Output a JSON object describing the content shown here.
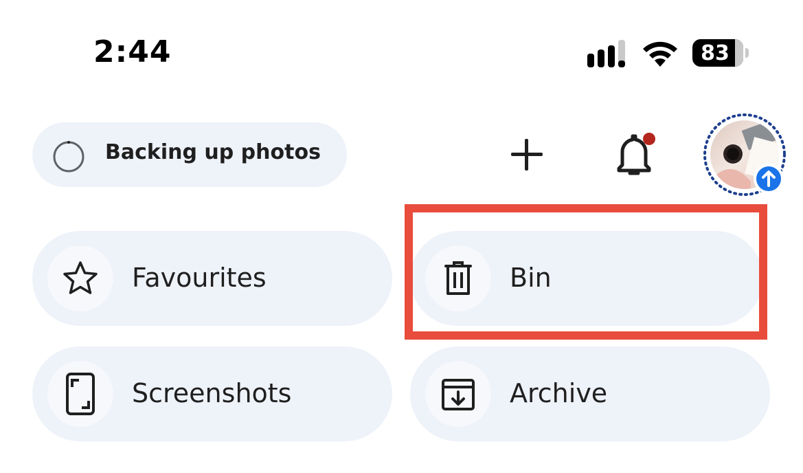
{
  "status_bar": {
    "time": "2:44",
    "battery_percent": "83",
    "icons": [
      "cellular-signal-icon",
      "wifi-icon",
      "battery-icon"
    ]
  },
  "header": {
    "backup_status_label": "Backing up photos",
    "icons": [
      "loading-spinner-icon",
      "plus-icon",
      "bell-icon",
      "avatar",
      "upload-arrow-icon"
    ],
    "notification_dot_color": "#b3261e",
    "upload_badge_color": "#1a73e8"
  },
  "collections": [
    {
      "label": "Favourites",
      "icon": "star-icon"
    },
    {
      "label": "Bin",
      "icon": "trash-icon"
    },
    {
      "label": "Screenshots",
      "icon": "screenshot-icon"
    },
    {
      "label": "Archive",
      "icon": "archive-icon"
    }
  ],
  "highlight_color": "#e84c3d",
  "tile_background": "#eef2f9"
}
